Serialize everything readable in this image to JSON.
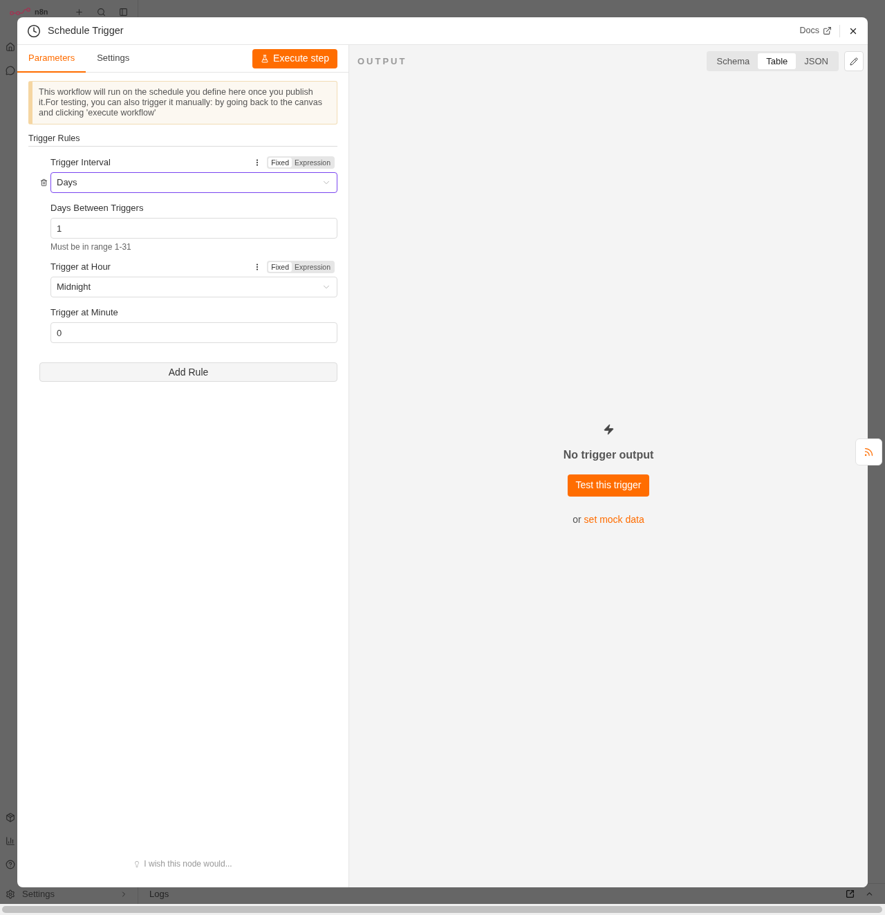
{
  "app": {
    "logo_text": "n8n",
    "sidebar_footer_item": "Settings",
    "logs_panel_title": "Logs"
  },
  "dialog": {
    "title": "Schedule Trigger",
    "docs_link": "Docs",
    "tabs": [
      {
        "label": "Parameters",
        "selected": true
      },
      {
        "label": "Settings",
        "selected": false
      }
    ],
    "execute_button": "Execute step",
    "notice": "This workflow will run on the schedule you define here once you publish it.For testing, you can also trigger it manually: by going back to the canvas and clicking 'execute workflow'",
    "section_title": "Trigger Rules",
    "fields": [
      {
        "kind": "select",
        "label": "Trigger Interval",
        "value": "Days",
        "focused": true,
        "deletable": true,
        "mode_toggle": [
          {
            "label": "Fixed",
            "selected": true
          },
          {
            "label": "Expression",
            "selected": false
          }
        ]
      },
      {
        "kind": "input",
        "label": "Days Between Triggers",
        "value": "1",
        "focused": false,
        "deletable": false,
        "hint": "Must be in range 1-31"
      },
      {
        "kind": "select",
        "label": "Trigger at Hour",
        "value": "Midnight",
        "focused": false,
        "deletable": false,
        "mode_toggle": [
          {
            "label": "Fixed",
            "selected": true
          },
          {
            "label": "Expression",
            "selected": false
          }
        ]
      },
      {
        "kind": "input",
        "label": "Trigger at Minute",
        "value": "0",
        "focused": false,
        "deletable": false
      }
    ],
    "add_button": "Add Rule",
    "feedback": "I wish this node would...",
    "output": {
      "title": "OUTPUT",
      "view_modes": [
        {
          "label": "Schema",
          "selected": false
        },
        {
          "label": "Table",
          "selected": true
        },
        {
          "label": "JSON",
          "selected": false
        }
      ],
      "empty_state": {
        "title": "No trigger output",
        "button": "Test this trigger",
        "alt_prefix": "or",
        "alt_link": "set mock data"
      }
    }
  }
}
